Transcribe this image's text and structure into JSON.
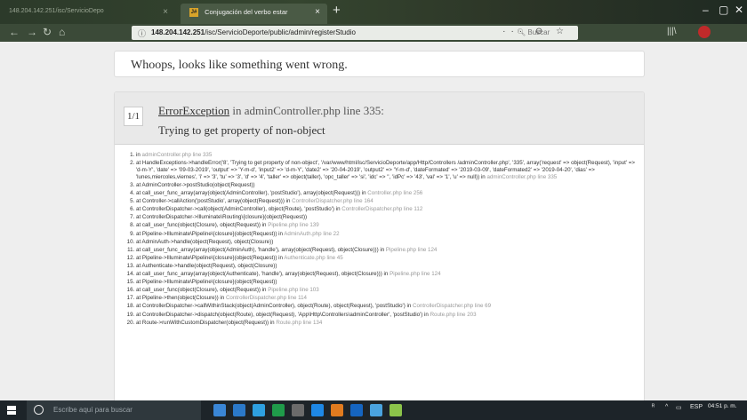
{
  "browser": {
    "tabs": [
      {
        "label": "148.204.142.251/isc/ServicioDepo",
        "active": false
      },
      {
        "label": "Conjugación del verbo estar",
        "active": true,
        "favicon": "J#"
      }
    ],
    "new_tab_glyph": "+",
    "url_host": "148.204.142.251",
    "url_path": "/isc/ServicioDeporte/public/admin/registerStudio",
    "url_tools": "··· ⊖ ☆",
    "search_placeholder": "Buscar"
  },
  "page": {
    "whoops": "Whoops, looks like something went wrong.",
    "counter": "1/1",
    "exception_name": "ErrorException",
    "exception_in": " in adminController.php line 335:",
    "exception_message": "Trying to get property of non-object",
    "trace": [
      {
        "text": "in ",
        "loc": "adminController.php line 335"
      },
      {
        "text": "at HandleExceptions->handleError('8', 'Trying to get property of non-object', '/var/www/html/isc/ServicioDeporte/app/Http/Controllers /adminController.php', '335', array('request' => object(Request), 'input' => 'd-m-Y', 'date' => '09-03-2019', 'output' => 'Y-m-d', 'input2' => 'd-m-Y', 'date2' => '20-04-2019', 'output2' => 'Y-m-d', 'dateFormated' => '2019-03-09', 'dateFormated2' => '2019-04-20', 'dias' => 'lunes,miercoles,viernes', 'i' => '3', 'tu' => '3', 'd' => '4', 'taller' => object(taller), 'opc_taller' => 'si', 'idc' => '', 'idPc' => '43', 'val' => '1', 'u' => null)) in ",
        "loc": "adminController.php line 335"
      },
      {
        "text": "at AdminController->postStudio(object(Request))",
        "loc": ""
      },
      {
        "text": "at call_user_func_array(array(object(AdminController), 'postStudio'), array(object(Request))) in ",
        "loc": "Controller.php line 256"
      },
      {
        "text": "at Controller->callAction('postStudio', array(object(Request))) in ",
        "loc": "ControllerDispatcher.php line 164"
      },
      {
        "text": "at ControllerDispatcher->call(object(AdminController), object(Route), 'postStudio') in ",
        "loc": "ControllerDispatcher.php line 112"
      },
      {
        "text": "at ControllerDispatcher->Illuminate\\Routing\\{closure}(object(Request))",
        "loc": ""
      },
      {
        "text": "at call_user_func(object(Closure), object(Request)) in ",
        "loc": "Pipeline.php line 139"
      },
      {
        "text": "at Pipeline->Illuminate\\Pipeline\\{closure}(object(Request)) in ",
        "loc": "AdminAuth.php line 22"
      },
      {
        "text": "at AdminAuth->handle(object(Request), object(Closure))",
        "loc": ""
      },
      {
        "text": "at call_user_func_array(array(object(AdminAuth), 'handle'), array(object(Request), object(Closure))) in ",
        "loc": "Pipeline.php line 124"
      },
      {
        "text": "at Pipeline->Illuminate\\Pipeline\\{closure}(object(Request)) in ",
        "loc": "Authenticate.php line 45"
      },
      {
        "text": "at Authenticate->handle(object(Request), object(Closure))",
        "loc": ""
      },
      {
        "text": "at call_user_func_array(array(object(Authenticate), 'handle'), array(object(Request), object(Closure))) in ",
        "loc": "Pipeline.php line 124"
      },
      {
        "text": "at Pipeline->Illuminate\\Pipeline\\{closure}(object(Request))",
        "loc": ""
      },
      {
        "text": "at call_user_func(object(Closure), object(Request)) in ",
        "loc": "Pipeline.php line 103"
      },
      {
        "text": "at Pipeline->then(object(Closure)) in ",
        "loc": "ControllerDispatcher.php line 114"
      },
      {
        "text": "at ControllerDispatcher->callWithinStack(object(AdminController), object(Route), object(Request), 'postStudio') in ",
        "loc": "ControllerDispatcher.php line 69"
      },
      {
        "text": "at ControllerDispatcher->dispatch(object(Route), object(Request), 'App\\Http\\Controllers\\adminController', 'postStudio') in ",
        "loc": "Route.php line 203"
      },
      {
        "text": "at Route->runWithCustomDispatcher(object(Request)) in ",
        "loc": "Route.php line 134"
      }
    ]
  },
  "taskbar": {
    "search_placeholder": "Escribe aquí para buscar",
    "lang": "ESP",
    "time": "04:51 p. m.",
    "apps": [
      "#3a86d6",
      "#2b79c9",
      "#2ea0e0",
      "#1f9b4a",
      "#6b6b6b",
      "#1e88e5",
      "#e07b1f",
      "#1565c0",
      "#4aa3df",
      "#8bc34a"
    ]
  },
  "colors": {
    "frame": "#35452f",
    "accent": "#d9a42a",
    "link": "#333333"
  }
}
